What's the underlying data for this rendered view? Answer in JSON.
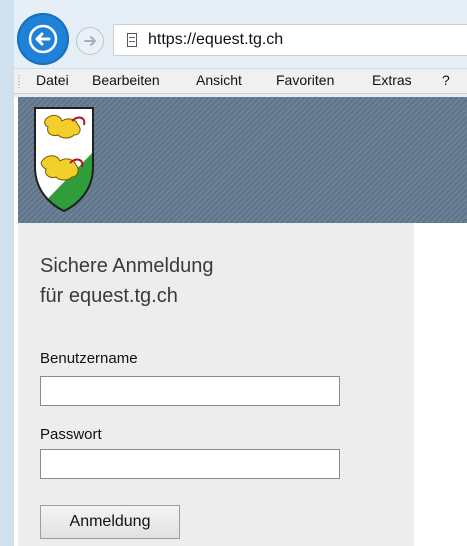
{
  "browser": {
    "url": "https://equest.tg.ch",
    "menu": [
      "Datei",
      "Bearbeiten",
      "Ansicht",
      "Favoriten",
      "Extras",
      "?"
    ]
  },
  "login": {
    "title_line1": "Sichere Anmeldung",
    "title_line2": "für equest.tg.ch",
    "username_label": "Benutzername",
    "username_value": "",
    "password_label": "Passwort",
    "password_value": "",
    "submit_label": "Anmeldung"
  },
  "colors": {
    "accent": "#1f82d8",
    "header_bg": "#6d8197",
    "panel_bg": "#ededed",
    "crest_green": "#2f9d3a",
    "crest_yellow": "#f2cf2a"
  }
}
